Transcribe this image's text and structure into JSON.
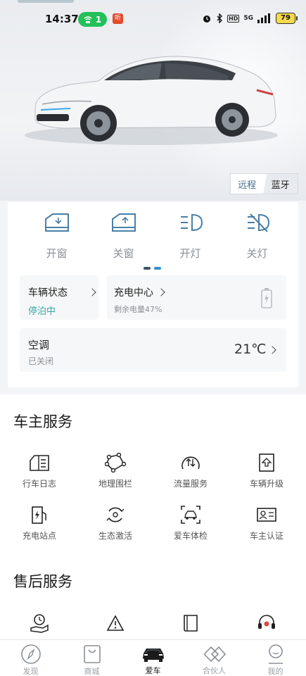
{
  "status_bar": {
    "time": "14:37",
    "hotspot_count": "1",
    "ting_badge": "听",
    "signal_label": "5G",
    "hd_label": "HD",
    "battery": "79"
  },
  "mode_toggle": {
    "remote": "远程",
    "bluetooth": "蓝牙"
  },
  "quick_controls": [
    {
      "label": "开窗",
      "icon": "window-down-icon"
    },
    {
      "label": "关窗",
      "icon": "window-up-icon"
    },
    {
      "label": "开灯",
      "icon": "headlight-on-icon"
    },
    {
      "label": "关灯",
      "icon": "headlight-off-icon"
    }
  ],
  "vehicle_status": {
    "title": "车辆状态",
    "value": "停泊中"
  },
  "charging": {
    "title": "充电中心",
    "value": "剩余电量47%"
  },
  "climate": {
    "title": "空调",
    "value": "已关闭",
    "temperature": "21℃"
  },
  "owner_services": {
    "title": "车主服务",
    "items": [
      {
        "label": "行车日志",
        "icon": "driving-log-icon"
      },
      {
        "label": "地理围栏",
        "icon": "geofence-icon"
      },
      {
        "label": "流量服务",
        "icon": "data-traffic-icon"
      },
      {
        "label": "车辆升级",
        "icon": "upgrade-icon"
      },
      {
        "label": "充电站点",
        "icon": "charging-station-icon"
      },
      {
        "label": "生态激活",
        "icon": "ecosystem-activate-icon"
      },
      {
        "label": "爱车体检",
        "icon": "car-checkup-icon"
      },
      {
        "label": "车主认证",
        "icon": "owner-id-icon"
      }
    ]
  },
  "after_sales": {
    "title": "售后服务",
    "items": [
      {
        "icon": "service-appointment-icon"
      },
      {
        "icon": "warning-icon"
      },
      {
        "icon": "manual-book-icon"
      },
      {
        "icon": "customer-support-icon"
      }
    ]
  },
  "tabs": [
    {
      "label": "发现",
      "icon": "compass-icon"
    },
    {
      "label": "商城",
      "icon": "shopping-bag-icon"
    },
    {
      "label": "爱车",
      "icon": "car-icon",
      "active": true
    },
    {
      "label": "合伙人",
      "icon": "partner-icon"
    },
    {
      "label": "我的",
      "icon": "profile-icon"
    }
  ],
  "colors": {
    "accent": "#2f8fd6",
    "status_teal": "#3aa7a6",
    "hotspot_green": "#24c05a"
  }
}
